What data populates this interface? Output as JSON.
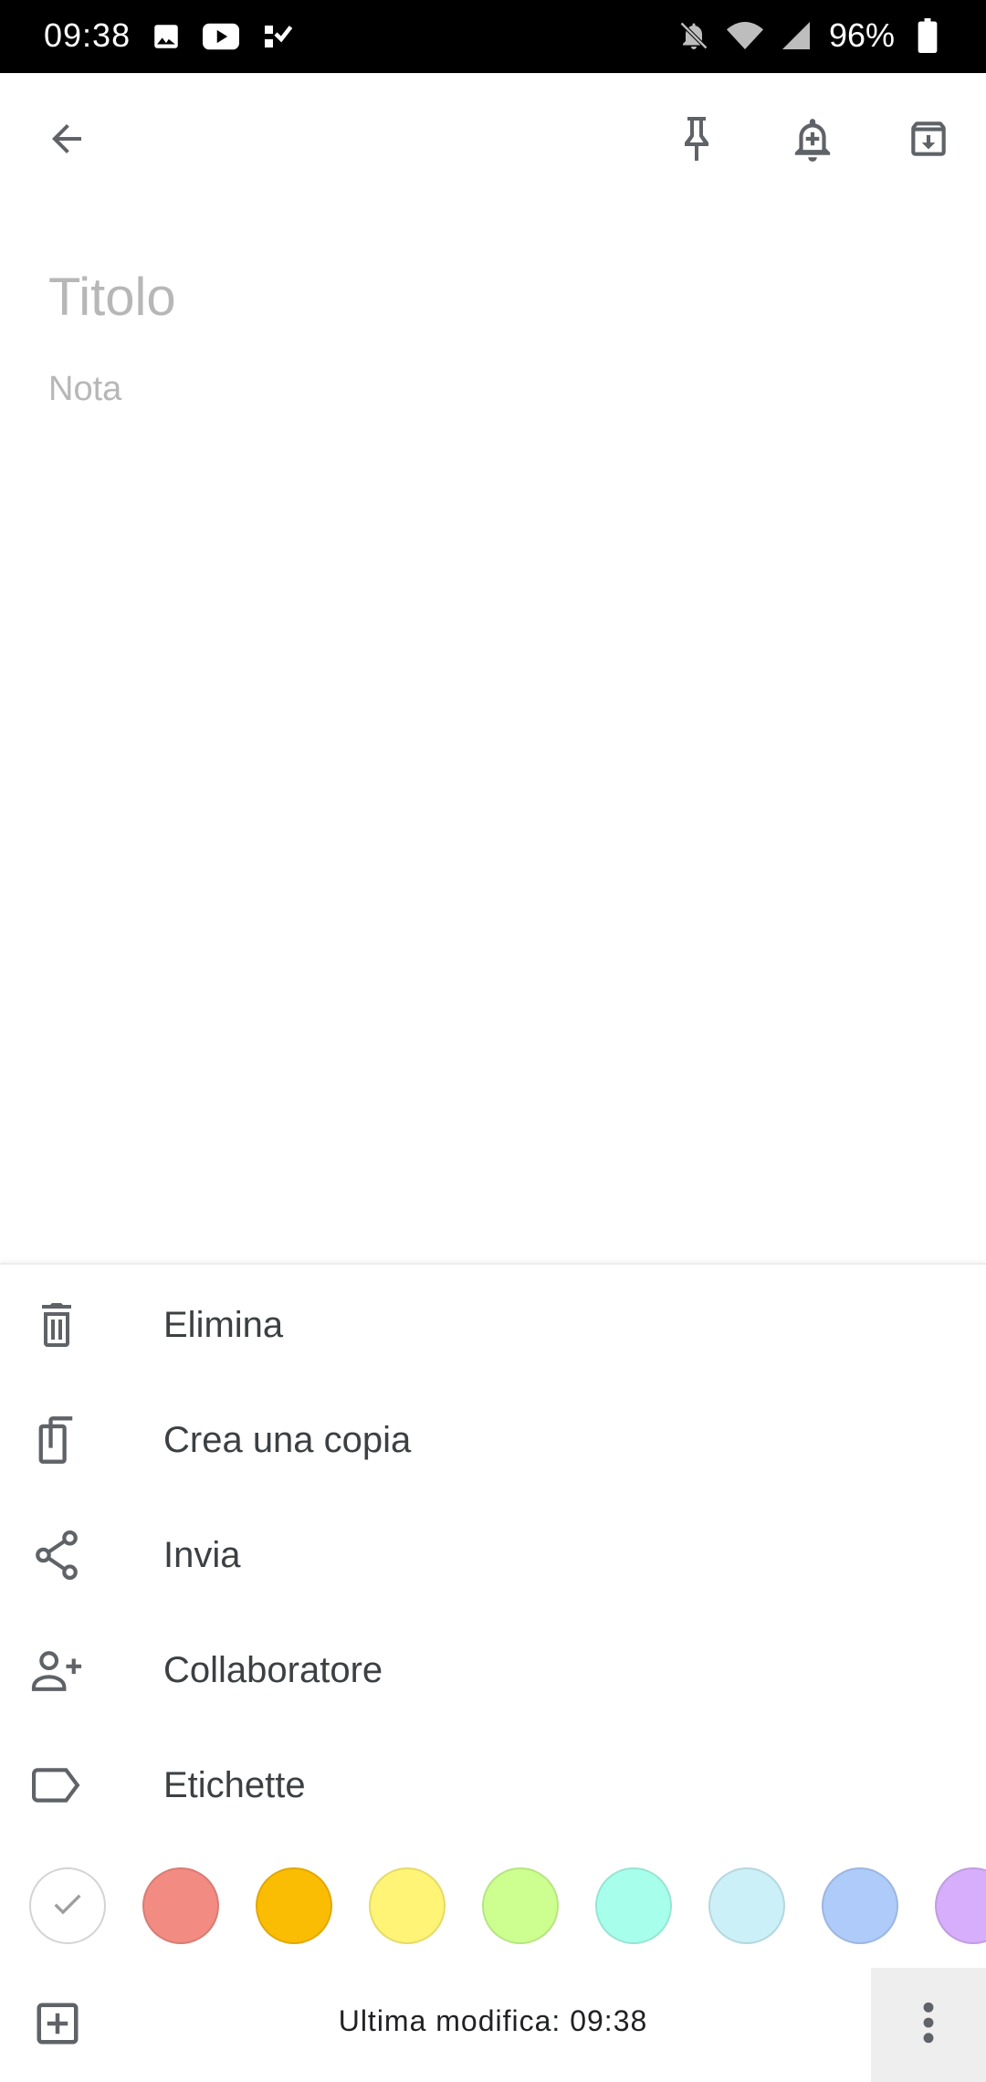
{
  "status_bar": {
    "time": "09:38",
    "battery": "96%",
    "left_icons": [
      "image-icon",
      "youtube-icon",
      "tasks-icon"
    ],
    "right_icons": [
      "notifications-off-icon",
      "wifi-icon",
      "signal-icon",
      "battery-icon"
    ]
  },
  "toolbar": {
    "icons": [
      "back-arrow-icon",
      "pin-icon",
      "add-reminder-icon",
      "archive-icon"
    ]
  },
  "note": {
    "title_placeholder": "Titolo",
    "body_placeholder": "Nota"
  },
  "menu": {
    "items": [
      {
        "label": "Elimina",
        "icon": "trash-icon"
      },
      {
        "label": "Crea una copia",
        "icon": "copy-icon"
      },
      {
        "label": "Invia",
        "icon": "share-icon"
      },
      {
        "label": "Collaboratore",
        "icon": "add-person-icon"
      },
      {
        "label": "Etichette",
        "icon": "label-icon"
      }
    ]
  },
  "colors": {
    "selected": "default",
    "palette": [
      "#ffffff",
      "#f28b82",
      "#fbbc04",
      "#fff475",
      "#ccff90",
      "#a7ffeb",
      "#cbf0f8",
      "#aecbfa",
      "#d7aefb"
    ]
  },
  "bottom_bar": {
    "last_edited": "Ultima modifica: 09:38"
  }
}
